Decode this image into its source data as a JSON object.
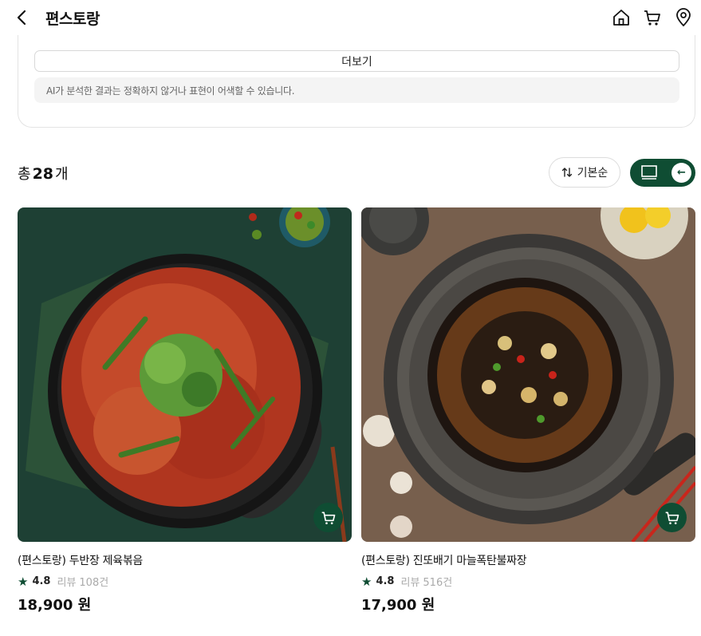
{
  "header": {
    "title": "편스토랑",
    "icons": [
      "back-icon",
      "home-icon",
      "cart-icon",
      "location-pin-icon"
    ]
  },
  "ai_summary": {
    "more_label": "더보기",
    "disclaimer": "AI가 분석한 결과는 정확하지 않거나 표현이 어색할 수 있습니다."
  },
  "list_toolbar": {
    "count_prefix": "총",
    "count_value": "28",
    "count_unit": "개",
    "sort_label": "기본순"
  },
  "products": [
    {
      "name": "(편스토랑) 두반장 제육볶음",
      "rating": "4.8",
      "review_label": "리뷰",
      "review_count": "108건",
      "price": "18,900 원"
    },
    {
      "name": "(편스토랑) 진또배기 마늘폭탄불짜장",
      "rating": "4.8",
      "review_label": "리뷰",
      "review_count": "516건",
      "price": "17,900 원"
    }
  ],
  "colors": {
    "brand_green": "#0f4d33",
    "card_border": "#e3e3e3",
    "muted_text": "#aaaaaa"
  }
}
